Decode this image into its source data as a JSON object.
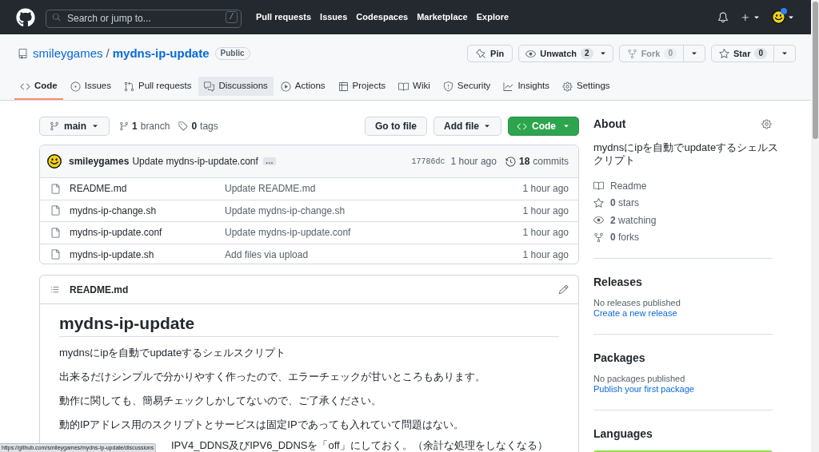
{
  "header": {
    "search": {
      "placeholder": "Search or jump to...",
      "shortcut": "/"
    },
    "nav": [
      {
        "label": "Pull requests"
      },
      {
        "label": "Issues"
      },
      {
        "label": "Codespaces"
      },
      {
        "label": "Marketplace"
      },
      {
        "label": "Explore"
      }
    ],
    "user_menu": {
      "badge": true
    }
  },
  "repo": {
    "owner": "smileygames",
    "separator": "/",
    "name": "mydns-ip-update",
    "visibility": "Public",
    "actions": [
      {
        "kind": "pin",
        "label": "Pin",
        "disabled": false
      },
      {
        "kind": "watch",
        "label": "Unwatch",
        "count": "2",
        "disabled": false
      },
      {
        "kind": "fork",
        "label": "Fork",
        "count": "0",
        "disabled": true
      },
      {
        "kind": "star",
        "label": "Star",
        "count": "0",
        "disabled": false
      }
    ]
  },
  "tabs": [
    {
      "kind": "code",
      "label": "Code",
      "selected": true,
      "hovered": false
    },
    {
      "kind": "issues",
      "label": "Issues",
      "selected": false,
      "hovered": false
    },
    {
      "kind": "pulls",
      "label": "Pull requests",
      "selected": false,
      "hovered": false
    },
    {
      "kind": "discussions",
      "label": "Discussions",
      "selected": false,
      "hovered": true
    },
    {
      "kind": "actions",
      "label": "Actions",
      "selected": false,
      "hovered": false
    },
    {
      "kind": "projects",
      "label": "Projects",
      "selected": false,
      "hovered": false
    },
    {
      "kind": "wiki",
      "label": "Wiki",
      "selected": false,
      "hovered": false
    },
    {
      "kind": "security",
      "label": "Security",
      "selected": false,
      "hovered": false
    },
    {
      "kind": "insights",
      "label": "Insights",
      "selected": false,
      "hovered": false
    },
    {
      "kind": "settings",
      "label": "Settings",
      "selected": false,
      "hovered": false
    }
  ],
  "toolbar": {
    "branch": "main",
    "branches": {
      "count": "1",
      "label": "branch"
    },
    "tags": {
      "count": "0",
      "label": "tags"
    },
    "buttons": [
      {
        "kind": "plain",
        "label": "Go to file"
      },
      {
        "kind": "menu",
        "label": "Add file"
      },
      {
        "kind": "primary",
        "label": "Code"
      }
    ]
  },
  "commit": {
    "author": "smileygames",
    "message": "Update mydns-ip-update.conf",
    "more": "…",
    "sha": "17786dc",
    "time": "1 hour ago",
    "commits": {
      "count": "18",
      "label": "commits"
    }
  },
  "files": [
    {
      "name": "README.md",
      "message": "Update README.md",
      "time": "1 hour ago"
    },
    {
      "name": "mydns-ip-change.sh",
      "message": "Update mydns-ip-change.sh",
      "time": "1 hour ago"
    },
    {
      "name": "mydns-ip-update.conf",
      "message": "Update mydns-ip-update.conf",
      "time": "1 hour ago"
    },
    {
      "name": "mydns-ip-update.sh",
      "message": "Add files via upload",
      "time": "1 hour ago"
    }
  ],
  "readme": {
    "filename": "README.md",
    "title": "mydns-ip-update",
    "paragraphs": [
      "mydnsにipを自動でupdateするシェルスクリプト",
      "出来るだけシンプルで分かりやすく作ったので、エラーチェックが甘いところもあります。",
      "動作に関しても、簡易チェックしかしてないので、ご了承ください。",
      "動的IPアドレス用のスクリプトとサービスは固定IPであっても入れていて問題はない。"
    ],
    "cut_line": "IPV4_DDNS及びIPV6_DDNSを「off」にしておく。（余計な処理をしなくなる）"
  },
  "about": {
    "title": "About",
    "description": "mydnsにipを自動でupdateするシェルスクリプト",
    "links": [
      {
        "kind": "readme",
        "label": "Readme"
      },
      {
        "kind": "stars",
        "count": "0",
        "label": "stars"
      },
      {
        "kind": "watching",
        "count": "2",
        "label": "watching"
      },
      {
        "kind": "forks",
        "count": "0",
        "label": "forks"
      }
    ]
  },
  "releases": {
    "title": "Releases",
    "note": "No releases published",
    "link": "Create a new release"
  },
  "packages": {
    "title": "Packages",
    "note": "No packages published",
    "link": "Publish your first package"
  },
  "languages": {
    "title": "Languages",
    "bar": [
      {
        "color": "#89e051",
        "level": 1
      }
    ]
  },
  "status_bar": {
    "url": "https://github.com/smileygames/mydns-ip-update/discussions"
  }
}
